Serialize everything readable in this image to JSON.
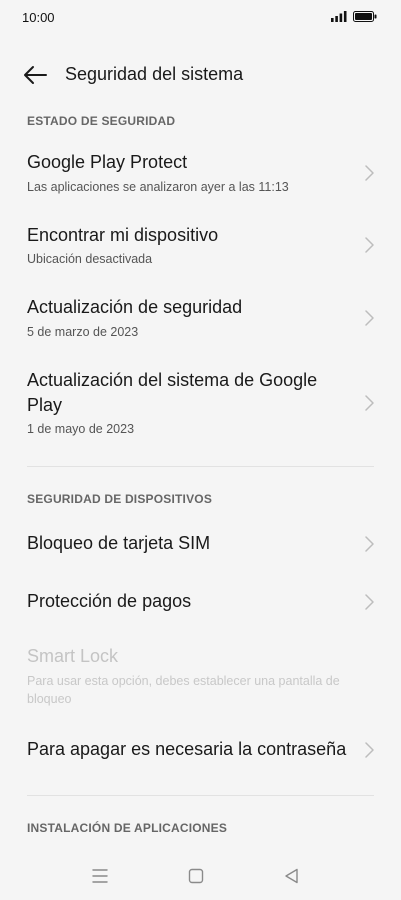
{
  "status_bar": {
    "time": "10:00"
  },
  "header": {
    "title": "Seguridad del sistema"
  },
  "sections": {
    "security_status": "ESTADO DE SEGURIDAD",
    "device_security": "SEGURIDAD DE DISPOSITIVOS",
    "app_install": "INSTALACIÓN DE APLICACIONES"
  },
  "rows": {
    "play_protect": {
      "title": "Google Play Protect",
      "subtitle": "Las aplicaciones se analizaron ayer a las 11:13"
    },
    "find_device": {
      "title": "Encontrar mi dispositivo",
      "subtitle": "Ubicación desactivada"
    },
    "security_update": {
      "title": "Actualización de seguridad",
      "subtitle": "5 de marzo de 2023"
    },
    "play_system_update": {
      "title": "Actualización del sistema de Google Play",
      "subtitle": "1 de mayo de 2023"
    },
    "sim_lock": {
      "title": "Bloqueo de tarjeta SIM"
    },
    "payment_protection": {
      "title": "Protección de pagos"
    },
    "smart_lock": {
      "title": "Smart Lock",
      "subtitle": "Para usar esta opción, debes establecer una pantalla de bloqueo"
    },
    "password_shutdown": {
      "title": "Para apagar es necesaria la contraseña"
    }
  },
  "icons": {
    "back": "arrow-left-icon",
    "chevron": "chevron-right-icon",
    "signal": "signal-icon",
    "battery": "battery-icon",
    "nav_menu": "menu-icon",
    "nav_home": "home-square-icon",
    "nav_back": "back-triangle-icon"
  },
  "colors": {
    "background": "#f5f5f5",
    "text_primary": "#1a1a1a",
    "text_secondary": "#555555",
    "section_header": "#666666",
    "disabled": "#c4c4c4",
    "chevron": "#bdbdbd",
    "divider": "#e2e2e2"
  }
}
